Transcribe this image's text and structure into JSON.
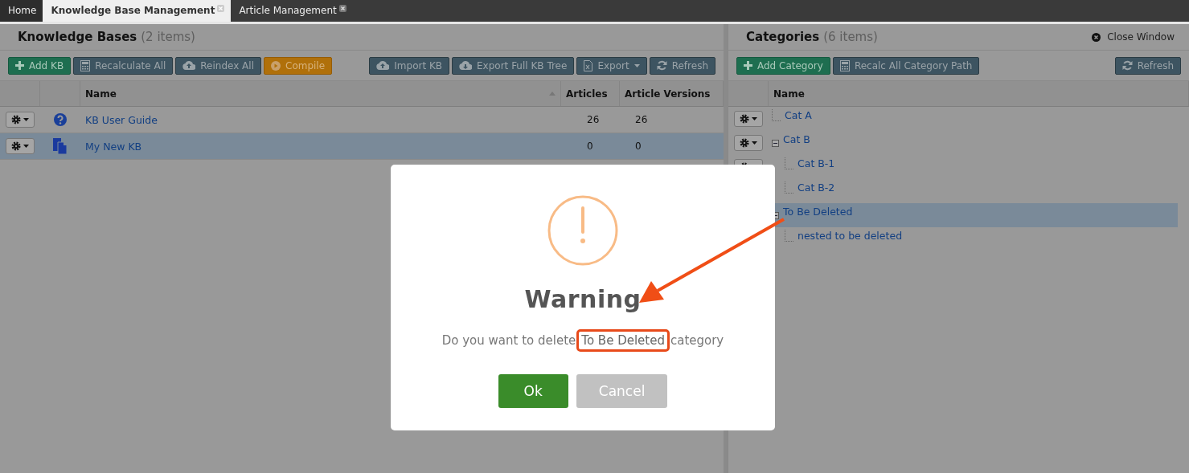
{
  "tabs": [
    {
      "label": "Home",
      "selected": false,
      "closable": false
    },
    {
      "label": "Knowledge Base Management",
      "selected": true,
      "closable": true
    },
    {
      "label": "Article Management",
      "selected": false,
      "closable": true
    }
  ],
  "kb_panel": {
    "title": "Knowledge Bases",
    "count": "(2 items)",
    "toolbar_left": [
      {
        "label": "Add KB",
        "kind": "add"
      },
      {
        "label": "Recalculate All",
        "kind": "calc"
      },
      {
        "label": "Reindex All",
        "kind": "upload"
      },
      {
        "label": "Compile",
        "kind": "compile"
      }
    ],
    "toolbar_right": [
      {
        "label": "Import KB",
        "kind": "upload"
      },
      {
        "label": "Export Full KB Tree",
        "kind": "download"
      },
      {
        "label": "Export",
        "kind": "excel"
      },
      {
        "label": "Refresh",
        "kind": "refresh"
      }
    ],
    "columns": [
      {
        "label": "Name",
        "sorted": true
      },
      {
        "label": "Articles",
        "sorted": false
      },
      {
        "label": "Article Versions",
        "sorted": false
      }
    ],
    "rows": [
      {
        "name": "KB User Guide",
        "articles": "26",
        "article_versions": "26",
        "kind": "help",
        "selected": false
      },
      {
        "name": "My New KB",
        "articles": "0",
        "article_versions": "0",
        "kind": "document",
        "selected": true
      }
    ]
  },
  "categories_panel": {
    "title": "Categories",
    "count": "(6 items)",
    "close_label": "Close Window",
    "toolbar_left": [
      {
        "label": "Add Category",
        "kind": "add"
      },
      {
        "label": "Recalc All Category Path",
        "kind": "calc"
      }
    ],
    "toolbar_right": [
      {
        "label": "Refresh",
        "kind": "refresh"
      }
    ],
    "columns": [
      {
        "label": "Name",
        "sorted": false
      }
    ],
    "tree": [
      {
        "label": "Cat A",
        "selected": false
      },
      {
        "label": "Cat B",
        "selected": false,
        "expanded": true,
        "children": [
          {
            "label": "Cat B-1",
            "selected": false
          },
          {
            "label": "Cat B-2",
            "selected": false
          }
        ]
      },
      {
        "label": "To Be Deleted",
        "selected": true,
        "expanded": true,
        "children": [
          {
            "label": "nested to be deleted",
            "selected": false
          }
        ]
      }
    ]
  },
  "dialog": {
    "title": "Warning",
    "message_before": "Do you want to delete",
    "highlight": "To Be Deleted",
    "message_after": "category",
    "buttons": [
      {
        "label": "Ok",
        "kind": "primary"
      },
      {
        "label": "Cancel",
        "kind": "secondary"
      }
    ]
  }
}
